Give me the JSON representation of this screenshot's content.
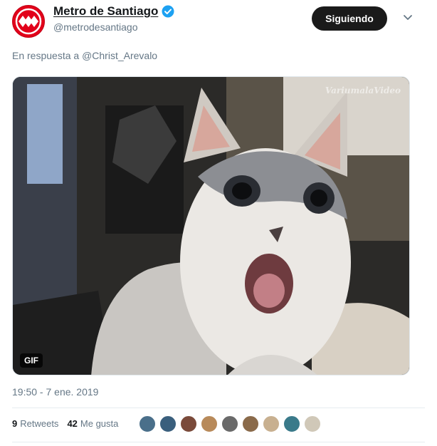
{
  "author": {
    "display_name": "Metro de Santiago",
    "handle": "@metrodesantiago",
    "avatar_icon": "metro-logo-icon",
    "brand_color": "#e2001a",
    "verified_icon": "verified-badge-icon"
  },
  "follow_button": {
    "label": "Siguiendo"
  },
  "menu_icon": "chevron-down-icon",
  "reply": {
    "prefix": "En respuesta a",
    "mention": "@Christ_Arevalo"
  },
  "media": {
    "badge": "GIF",
    "watermark": "VariumalaVideo"
  },
  "timestamp": "19:50 - 7 ene. 2019",
  "stats": {
    "retweets_count": "9",
    "retweets_label": "Retweets",
    "likes_count": "42",
    "likes_label": "Me gusta"
  },
  "likers": [
    {
      "color": "#4a6f8a"
    },
    {
      "color": "#3a5f7d"
    },
    {
      "color": "#7a4a3a"
    },
    {
      "color": "#b88a5a"
    },
    {
      "color": "#6a6a6a"
    },
    {
      "color": "#8a6a4a"
    },
    {
      "color": "#c8b090"
    },
    {
      "color": "#3a7a8a"
    },
    {
      "color": "#d0c8b8"
    }
  ]
}
